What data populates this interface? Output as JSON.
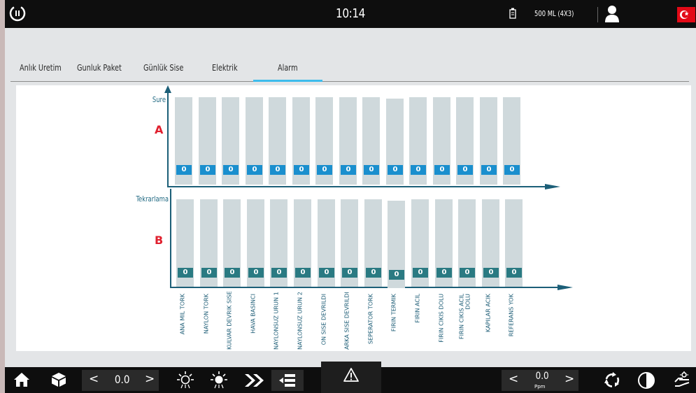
{
  "topbar": {
    "clock": "10:14",
    "product": "500 ML  (4X3)"
  },
  "tabs": [
    {
      "label": "Anlık Uretim"
    },
    {
      "label": "Gunluk Paket"
    },
    {
      "label": "Günlük Sise"
    },
    {
      "label": "Elektrik"
    },
    {
      "label": "Alarm"
    }
  ],
  "active_tab": "Alarm",
  "chart": {
    "section_a": {
      "letter": "A",
      "axis_title": "Sure"
    },
    "section_b": {
      "letter": "B",
      "axis_title": "Tekrarlama"
    },
    "categories": [
      {
        "label": "ANA MIL TORK",
        "a": "0",
        "b": "0"
      },
      {
        "label": "NAYLON TORK",
        "a": "0",
        "b": "0"
      },
      {
        "label": "KULVAR DEVRIK SISE",
        "a": "0",
        "b": "0"
      },
      {
        "label": "HAVA BASINCI",
        "a": "0",
        "b": "0"
      },
      {
        "label": "NAYLONSUZ URUN 1",
        "a": "0",
        "b": "0"
      },
      {
        "label": "NAYLONSUZ  URUN 2",
        "a": "0",
        "b": "0"
      },
      {
        "label": "ON SISE DEVRILDI",
        "a": "0",
        "b": "0"
      },
      {
        "label": "ARKA SISE DEVRILDI",
        "a": "0",
        "b": "0"
      },
      {
        "label": "SEPERATOR TORK",
        "a": "0",
        "b": "0"
      },
      {
        "label": "FIRIN TERMIK",
        "a": "0",
        "b": "0"
      },
      {
        "label": "FIRIN ACIL",
        "a": "0",
        "b": "0"
      },
      {
        "label": "FIRIN CIKIS DOLU",
        "a": "0",
        "b": "0"
      },
      {
        "label": "FIRIN CIKIS ACIL DOLU",
        "a": "0",
        "b": "0"
      },
      {
        "label": "KAPILAR ACIK",
        "a": "0",
        "b": "0"
      },
      {
        "label": "REFERANS YOK",
        "a": "0",
        "b": "0"
      }
    ]
  },
  "bottombar": {
    "left_value": "0.0",
    "right_value": "0.0",
    "right_unit": "Ppm",
    "prev_symbol": "<",
    "next_symbol": ">"
  },
  "colors": {
    "accent_tab": "#3dbcec",
    "value_a": "#1a8fce",
    "value_b": "#2a7a82",
    "section_letter": "#e0202e",
    "axis": "#1c5f78"
  },
  "icons": [
    "power-icon",
    "bottle-icon",
    "user-icon",
    "turkish-flag-icon",
    "home-icon",
    "box-icon",
    "light-off-icon",
    "light-on-icon",
    "fast-forward-icon",
    "menu-list-icon",
    "warning-icon",
    "recycle-icon",
    "contrast-icon",
    "hand-settings-icon"
  ]
}
